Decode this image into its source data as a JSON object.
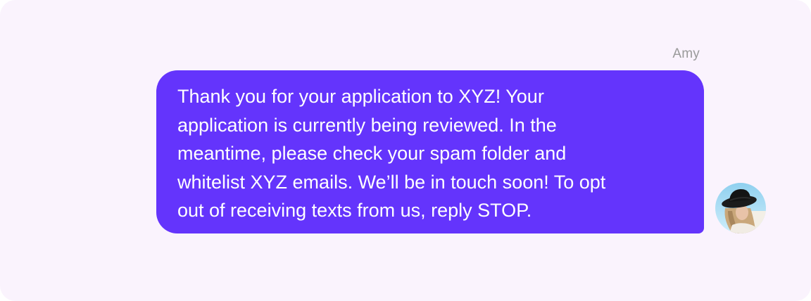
{
  "conversation": {
    "sender_name": "Amy",
    "message_text": "Thank you for your application to XYZ! Your\napplication is currently being reviewed. In the\nmeantime, please check your spam folder and\nwhitelist XYZ emails. We’ll be in touch soon! To opt\nout of receiving texts from us, reply STOP.",
    "avatar_icon": "person-with-hat-photo"
  },
  "colors": {
    "background": "#faf3fd",
    "bubble": "#6434fc",
    "bubble_text": "#ffffff",
    "sender_name": "#9a9a9a"
  }
}
